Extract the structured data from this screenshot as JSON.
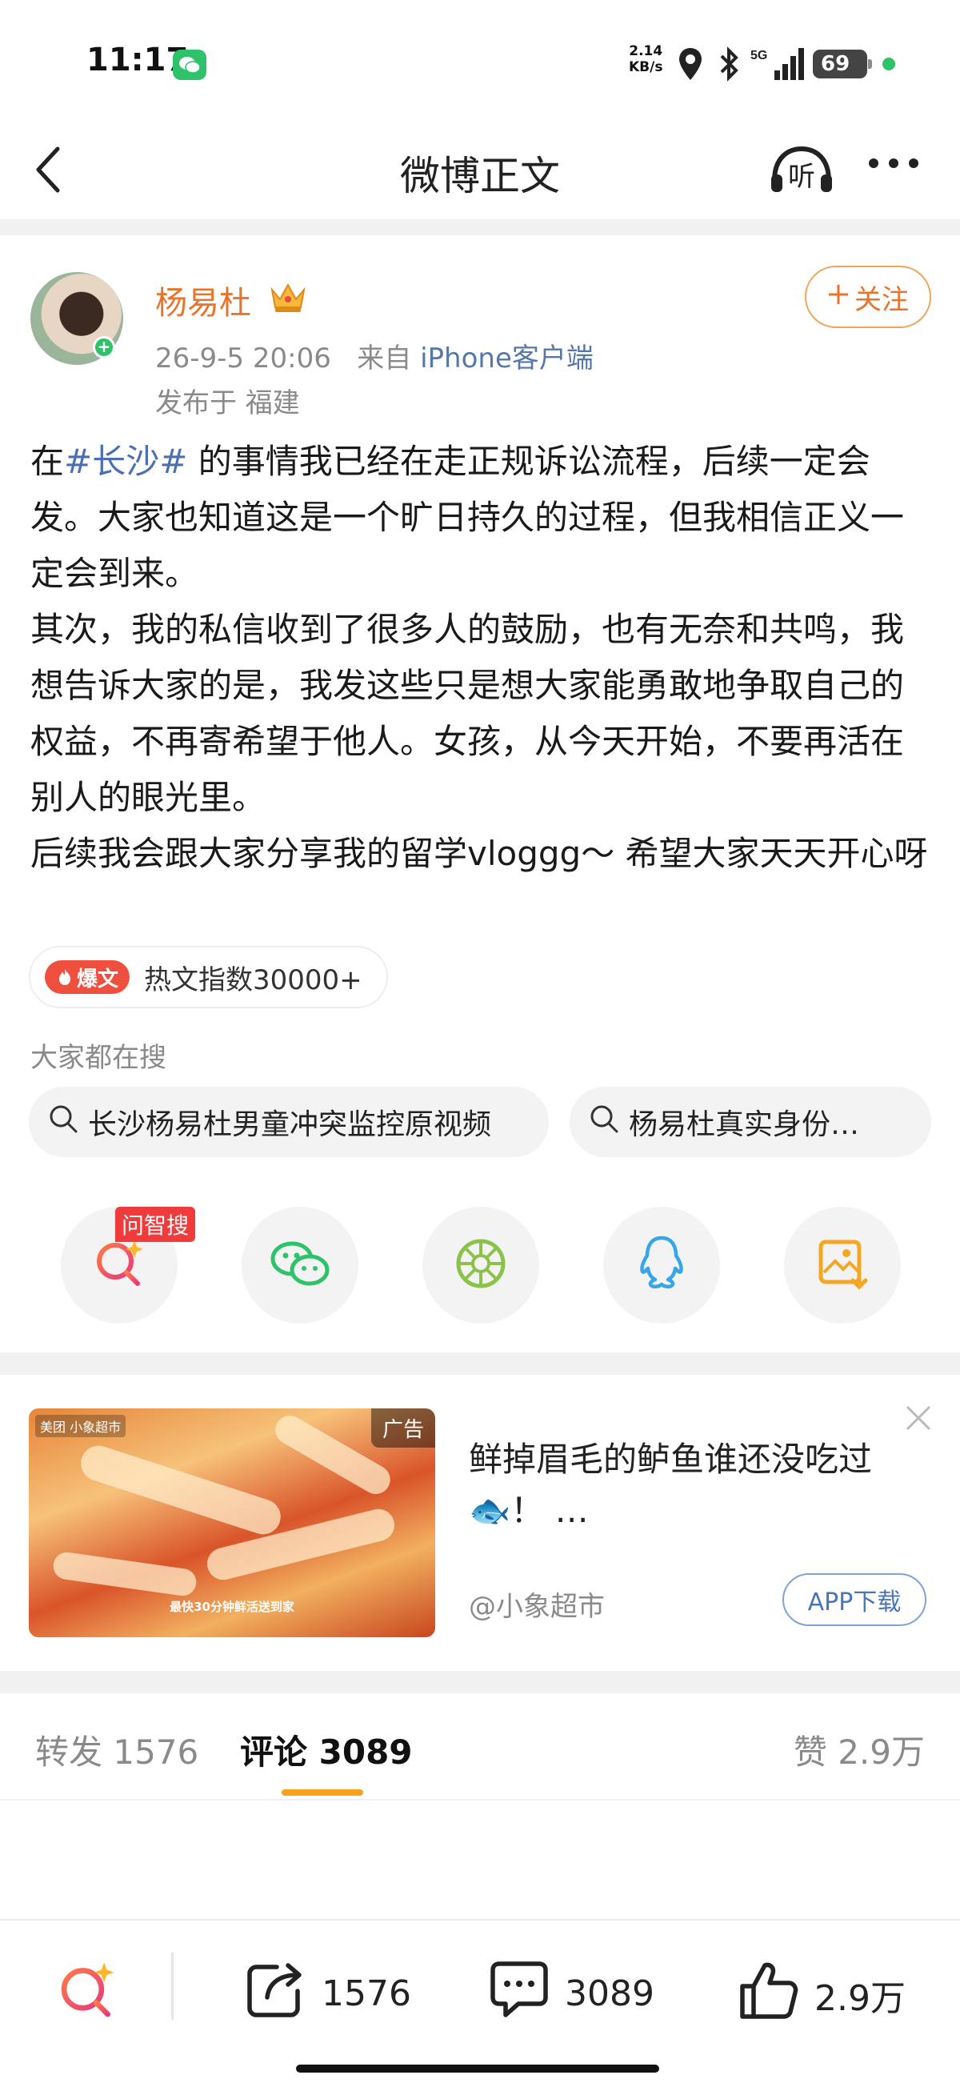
{
  "status_bar": {
    "time": "11:17",
    "net_speed_value": "2.14",
    "net_speed_unit": "KB/s",
    "signal_label": "5G",
    "battery": "69"
  },
  "nav": {
    "title": "微博正文",
    "listen_label": "听"
  },
  "post": {
    "author": "杨易杜",
    "date": "26-9-5 20:06",
    "from_prefix": "来自",
    "client": "iPhone客户端",
    "location": "发布于 福建",
    "follow_label": "关注",
    "paragraph1_prefix": "在",
    "hashtag": "#长沙#",
    "paragraph1_rest": " 的事情我已经在走正规诉讼流程，后续一定会发。大家也知道这是一个旷日持久的过程，但我相信正义一定会到来。",
    "paragraph2": "其次，我的私信收到了很多人的鼓励，也有无奈和共鸣，我想告诉大家的是，我发这些只是想大家能勇敢地争取自己的权益，不再寄希望于他人。女孩，从今天开始，不要再活在别人的眼光里。",
    "paragraph3": "后续我会跟大家分享我的留学vloggg～ 希望大家天天开心呀",
    "hot_badge": "爆文",
    "hot_index": "热文指数30000+"
  },
  "search": {
    "hint": "大家都在搜",
    "items": [
      "长沙杨易杜男童冲突监控原视频",
      "杨易杜真实身份…"
    ]
  },
  "share": {
    "wenzhisou_tag": "问智搜",
    "icons": [
      "wenzhisou-search-icon",
      "wechat-icon",
      "moments-icon",
      "qq-icon",
      "save-image-icon"
    ]
  },
  "ad": {
    "tag": "广告",
    "brand": "美团 小象超市",
    "caption": "最快30分钟鲜活送到家",
    "title": "鲜掉眉毛的鲈鱼谁还没吃过🐟！ …",
    "source": "@小象超市",
    "download": "APP下载"
  },
  "tabs": {
    "repost": "转发 1576",
    "comment": "评论 3089",
    "like": "赞 2.9万"
  },
  "bottom": {
    "repost_count": "1576",
    "comment_count": "3089",
    "like_count": "2.9万"
  },
  "colors": {
    "accent_orange": "#e8742c",
    "tab_underline": "#f7a21b",
    "link_blue": "#4a6fb3",
    "hot_red": "#ef4f3e"
  }
}
